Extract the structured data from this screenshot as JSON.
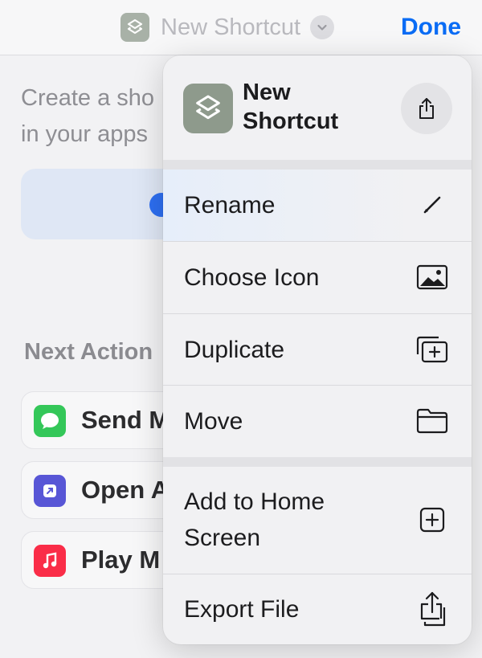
{
  "navbar": {
    "title": "New Shortcut",
    "done_label": "Done"
  },
  "background": {
    "description_line1": "Create a sho",
    "description_line2": "in your apps",
    "next_actions_heading": "Next Action",
    "suggestions": [
      {
        "label": "Send M",
        "icon": "messages-icon",
        "color": "#34c759"
      },
      {
        "label": "Open A",
        "icon": "open-app-icon",
        "color": "#5856d6"
      },
      {
        "label": "Play M",
        "icon": "music-icon",
        "color": "#fa2d48"
      }
    ]
  },
  "menu": {
    "title": "New Shortcut",
    "items": [
      {
        "label": "Rename",
        "icon": "pencil-icon"
      },
      {
        "label": "Choose Icon",
        "icon": "photo-icon"
      },
      {
        "label": "Duplicate",
        "icon": "duplicate-icon"
      },
      {
        "label": "Move",
        "icon": "folder-icon"
      },
      {
        "label": "Add to Home Screen",
        "icon": "add-square-icon"
      },
      {
        "label": "Export File",
        "icon": "export-icon"
      }
    ]
  },
  "colors": {
    "accent": "#0a6cf5",
    "shortcut_icon": "#8e9a8c"
  }
}
